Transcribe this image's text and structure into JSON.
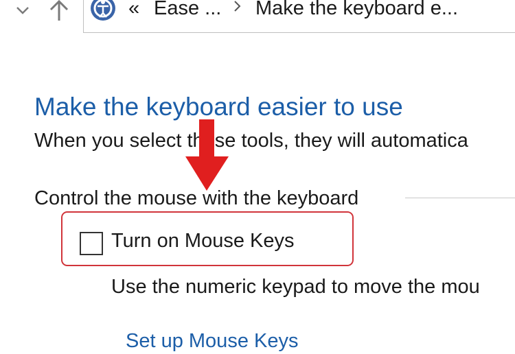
{
  "address_bar": {
    "overflow_marker": "«",
    "crumbs": [
      "Ease ...",
      "Make the keyboard e..."
    ]
  },
  "main": {
    "title": "Make the keyboard easier to use",
    "description": "When you select these tools, they will automatica",
    "section_heading": "Control the mouse with the keyboard",
    "mouse_keys": {
      "label": "Turn on Mouse Keys",
      "checked": false,
      "description": "Use the numeric keypad to move the mou",
      "setup_link": "Set up Mouse Keys"
    }
  },
  "colors": {
    "title_blue": "#1c5ea8",
    "highlight_red": "#d1343a",
    "arrow_red": "#e01f1f"
  },
  "icons": [
    "chevron-down-icon",
    "up-arrow-icon",
    "ease-of-access-icon",
    "breadcrumb-separator-icon",
    "annotation-arrow-icon"
  ]
}
